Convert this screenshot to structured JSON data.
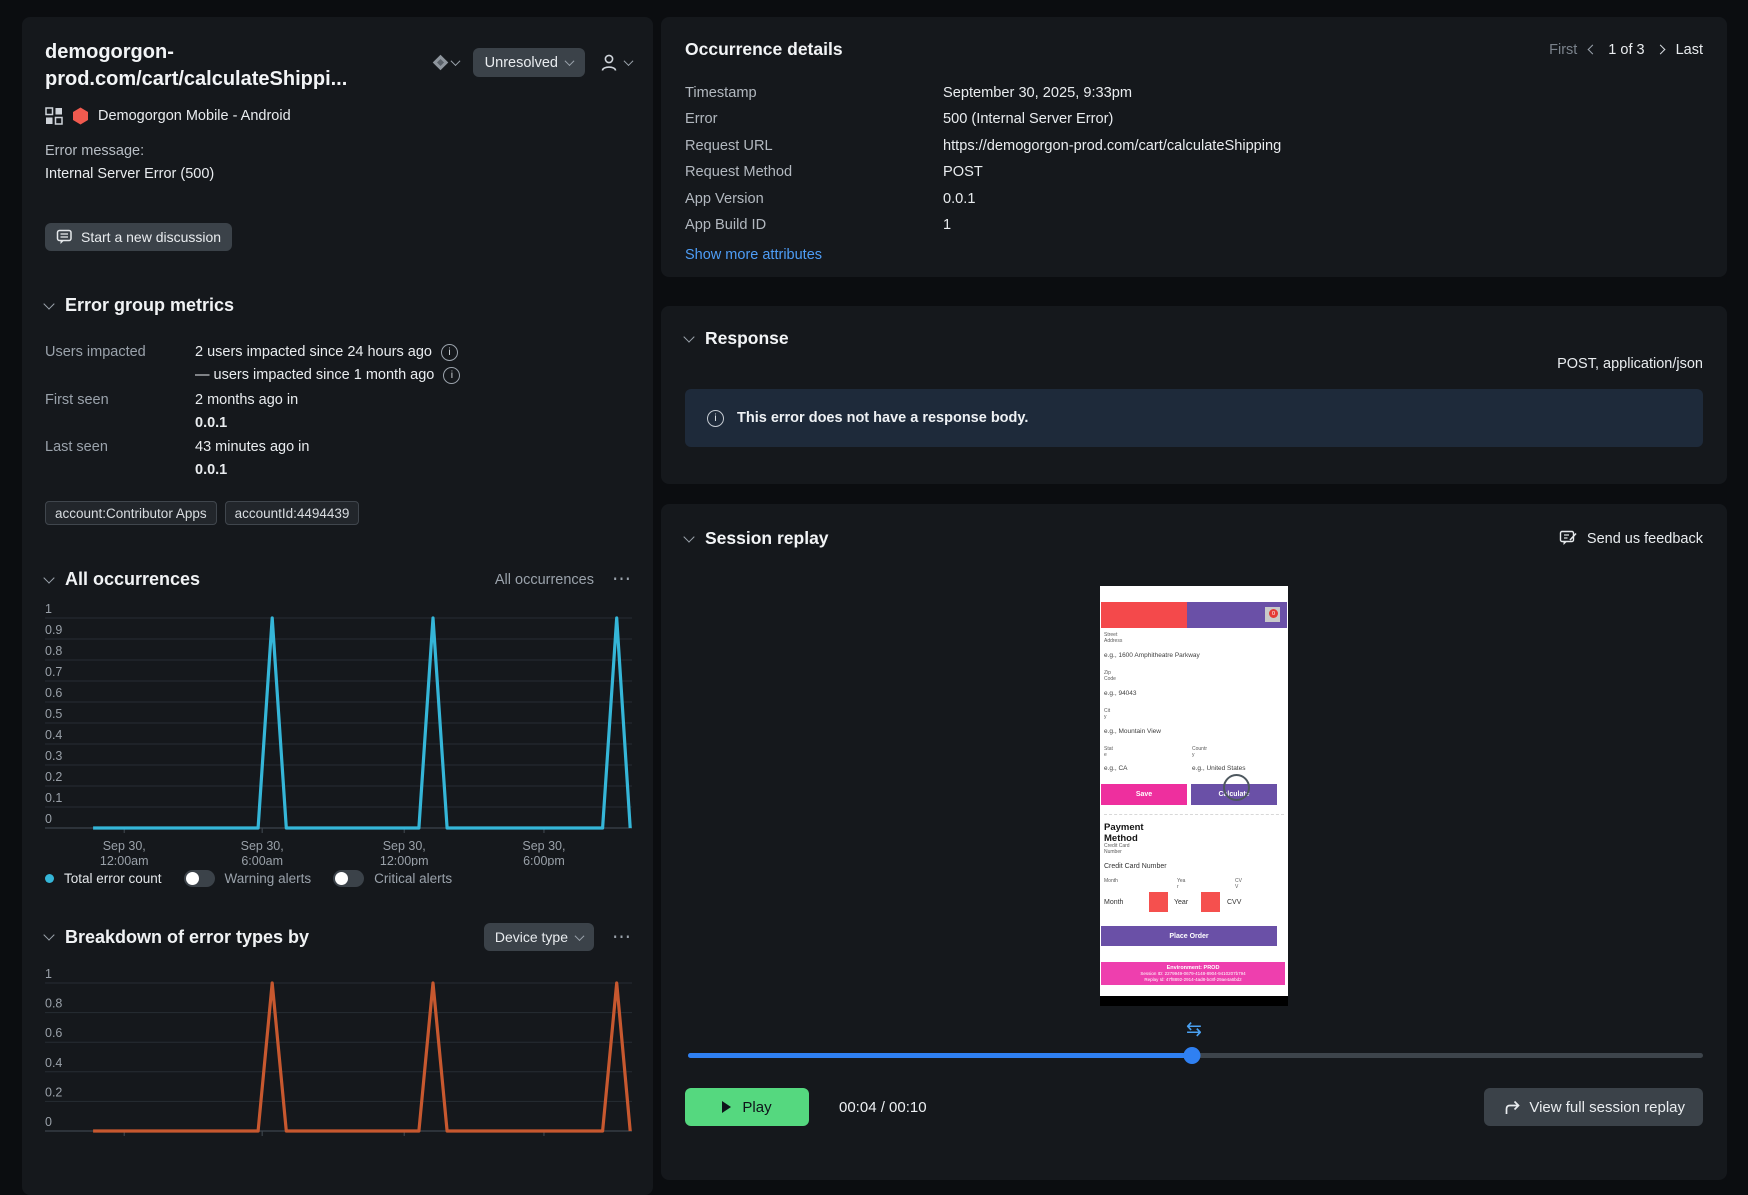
{
  "colors": {
    "background": "#0b0d10",
    "card": "#15181c",
    "accent_cyan": "#35b6d8",
    "accent_orange": "#c7582f",
    "accent_green": "#55d87f",
    "accent_blue": "#2f80f2",
    "link_blue": "#4e9df6",
    "hexagon_red": "#f05a4f"
  },
  "icons": {
    "info_glyph": "i",
    "dots_glyph": "⋯",
    "loop_glyph": "⇆"
  },
  "issue": {
    "title": "demogorgon-\nprod.com/cart/calculateShippi...",
    "status": "Unresolved",
    "app_name": "Demogorgon Mobile - Android",
    "error_message_label": "Error message:",
    "error_message": "Internal Server Error (500)",
    "discussion_button": "Start a new discussion"
  },
  "metrics": {
    "title": "Error group metrics",
    "users_impacted_label": "Users impacted",
    "users_line1": "2 users impacted since 24 hours ago",
    "users_line2": "— users impacted since 1 month ago",
    "first_seen_label": "First seen",
    "first_seen_line1": "2 months ago in",
    "first_seen_version": "0.0.1",
    "last_seen_label": "Last seen",
    "last_seen_line1": "43 minutes ago in",
    "last_seen_version": "0.0.1",
    "tag1": "account:Contributor Apps",
    "tag2": "accountId:4494439"
  },
  "occurrences_section": {
    "title": "All occurrences",
    "selector": "All occurrences",
    "legend_series": "Total error count",
    "legend_warning": "Warning alerts",
    "legend_critical": "Critical alerts"
  },
  "breakdown_section": {
    "title": "Breakdown of error types by",
    "selector": "Device type"
  },
  "occurrence_details": {
    "title": "Occurrence details",
    "pagination": {
      "first": "First",
      "current": "1 of 3",
      "last": "Last"
    },
    "rows": [
      {
        "label": "Timestamp",
        "value": "September 30, 2025, 9:33pm"
      },
      {
        "label": "Error",
        "value": "500 (Internal Server Error)"
      },
      {
        "label": "Request URL",
        "value": "https://demogorgon-prod.com/cart/calculateShipping"
      },
      {
        "label": "Request Method",
        "value": "POST"
      },
      {
        "label": "App Version",
        "value": "0.0.1"
      },
      {
        "label": "App Build ID",
        "value": "1"
      }
    ],
    "show_more": "Show more attributes"
  },
  "response": {
    "title": "Response",
    "content_type": "POST, application/json",
    "empty_message": "This error does not have a response body."
  },
  "replay": {
    "title": "Session replay",
    "feedback": "Send us feedback",
    "play_label": "Play",
    "time": "00:04 / 00:10",
    "view_full_label": "View full session replay",
    "progress_fraction": 0.497,
    "phone": {
      "header_badge": "0",
      "street_label": "Street\nAddress",
      "street_ph": "e.g., 1600 Amphitheatre Parkway",
      "zip_label": "Zip\nCode",
      "zip_ph": "e.g., 94043",
      "city_label": "Cit\ny",
      "city_ph": "e.g., Mountain View",
      "state_label": "Stat\ne",
      "state_ph": "e.g., CA",
      "country_label": "Countr\ny",
      "country_ph": "e.g., United States",
      "save": "Save",
      "calculate": "Calculate",
      "payment_title": "Payment\nMethod",
      "payment_sub": "Credit Card\nNumber",
      "cc_label": "Credit Card Number",
      "month_small": "Month",
      "year_small": "Yea\nr",
      "cvv_small": "CV\nV",
      "month": "Month",
      "year": "Year",
      "cvv": "CVV",
      "place_order": "Place Order",
      "footer_line1": "Environment: PROD",
      "footer_line2": "Session ID: 2279949-0679-4148-8904-9410207b794",
      "footer_line3": "Replay Id: 47f8892-2914-4ad8-bc8f-29ae4a6bd2"
    }
  },
  "chart_data": [
    {
      "id": "all-occurrences",
      "type": "line",
      "title": "All occurrences",
      "ylabel": "",
      "xlabel": "",
      "ylim": [
        0,
        1
      ],
      "grid": true,
      "legend": [
        "Total error count",
        "Warning alerts",
        "Critical alerts"
      ],
      "y_ticks": [
        1,
        0.9,
        0.8,
        0.7,
        0.6,
        0.5,
        0.4,
        0.3,
        0.2,
        0.1,
        0
      ],
      "x_ticks": [
        {
          "f": 0.135,
          "label": [
            "Sep 30,",
            "12:00am"
          ]
        },
        {
          "f": 0.37,
          "label": [
            "Sep 30,",
            "6:00am"
          ]
        },
        {
          "f": 0.612,
          "label": [
            "Sep 30,",
            "12:00pm"
          ]
        },
        {
          "f": 0.85,
          "label": [
            "Sep 30,",
            "6:00pm"
          ]
        }
      ],
      "series": [
        {
          "name": "Total error count",
          "color": "#35b6d8",
          "points": [
            [
              0.082,
              0
            ],
            [
              0.363,
              0
            ],
            [
              0.387,
              1
            ],
            [
              0.411,
              0
            ],
            [
              0.637,
              0
            ],
            [
              0.661,
              1
            ],
            [
              0.685,
              0
            ],
            [
              0.95,
              0
            ],
            [
              0.974,
              1
            ],
            [
              0.997,
              0
            ]
          ]
        }
      ],
      "note": "Spikes of 1 error at ~6:26am, ~1:15pm and ~9:33pm on Sep 30; 0 elsewhere"
    },
    {
      "id": "error-type-breakdown",
      "type": "line",
      "title": "Breakdown of error types by Device type",
      "ylim": [
        0,
        1
      ],
      "grid": true,
      "y_ticks": [
        1,
        0.8,
        0.6,
        0.4,
        0.2,
        0
      ],
      "x_ticks": [
        {
          "f": 0.135,
          "label": []
        },
        {
          "f": 0.37,
          "label": []
        },
        {
          "f": 0.612,
          "label": []
        },
        {
          "f": 0.85,
          "label": []
        }
      ],
      "series": [
        {
          "name": "Device type",
          "color": "#c7582f",
          "points": [
            [
              0.082,
              0
            ],
            [
              0.363,
              0
            ],
            [
              0.387,
              1
            ],
            [
              0.411,
              0
            ],
            [
              0.637,
              0
            ],
            [
              0.661,
              1
            ],
            [
              0.685,
              0
            ],
            [
              0.95,
              0
            ],
            [
              0.974,
              1
            ],
            [
              0.997,
              0
            ]
          ]
        }
      ],
      "note": "Same three spikes as All occurrences; x-axis labels cut off at bottom of viewport"
    }
  ]
}
